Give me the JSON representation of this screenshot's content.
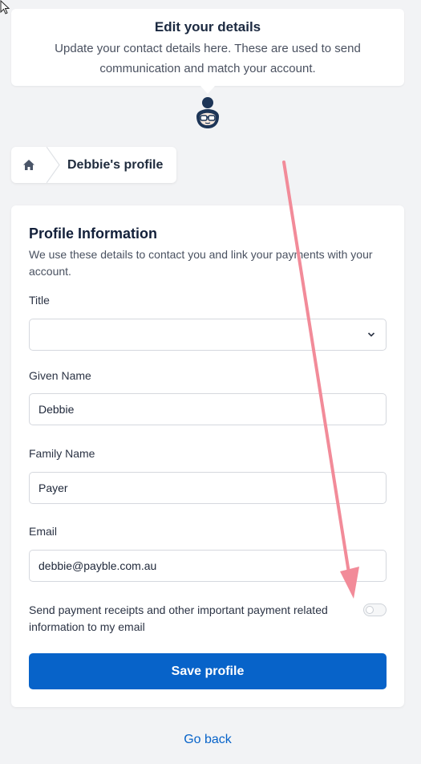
{
  "header": {
    "title": "Edit your details",
    "subtitle": "Update your contact details here. These are used to send communication and match your account.",
    "avatar_icon": "woman-with-glasses-icon"
  },
  "breadcrumb": {
    "home_icon": "home-icon",
    "current": "Debbie's profile"
  },
  "profile": {
    "title": "Profile Information",
    "description": "We use these details to contact you and link your payments with your account.",
    "fields": {
      "title_label": "Title",
      "title_value": "",
      "given_label": "Given Name",
      "given_value": "Debbie",
      "family_label": "Family Name",
      "family_value": "Payer",
      "email_label": "Email",
      "email_value": "debbie@payble.com.au"
    },
    "consent_text": "Send payment receipts and other important payment related information to my email",
    "consent_enabled": false,
    "save_label": "Save profile"
  },
  "footer": {
    "go_back": "Go back"
  },
  "colors": {
    "primary": "#0763c9",
    "background": "#f2f3f5",
    "annotation_arrow": "#f28b99"
  }
}
